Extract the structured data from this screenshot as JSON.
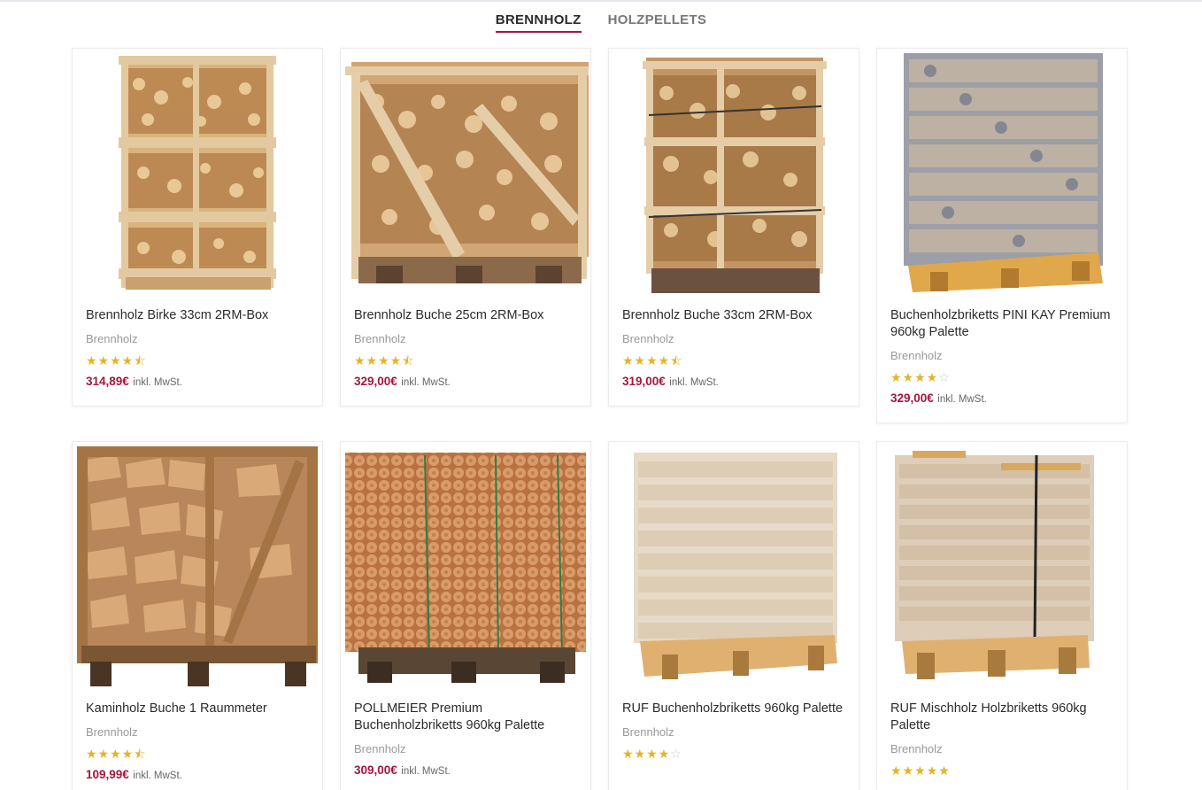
{
  "tabs": [
    {
      "label": "BRENNHOLZ",
      "active": true
    },
    {
      "label": "HOLZPELLETS",
      "active": false
    }
  ],
  "products": [
    {
      "title": "Brennholz Birke 33cm 2RM-Box",
      "category": "Brennholz",
      "rating": 4.5,
      "price": "314,89€",
      "tax_note": "inkl. MwSt.",
      "image": "stacked-birch-firewood-crates"
    },
    {
      "title": "Brennholz Buche 25cm 2RM-Box",
      "category": "Brennholz",
      "rating": 4.5,
      "price": "329,00€",
      "tax_note": "inkl. MwSt.",
      "image": "beech-firewood-crate-wrapped"
    },
    {
      "title": "Brennholz Buche 33cm 2RM-Box",
      "category": "Brennholz",
      "rating": 4.5,
      "price": "319,00€",
      "tax_note": "inkl. MwSt.",
      "image": "beech-firewood-crate-strapped"
    },
    {
      "title": "Buchenholzbriketts PINI KAY Premium 960kg Palette",
      "category": "Brennholz",
      "rating": 4,
      "price": "329,00€",
      "tax_note": "inkl. MwSt.",
      "image": "pini-kay-briquette-pallet"
    },
    {
      "title": "Kaminholz Buche 1 Raummeter",
      "category": "Brennholz",
      "rating": 4.5,
      "price": "109,99€",
      "tax_note": "inkl. MwSt.",
      "image": "fireplace-wood-crate"
    },
    {
      "title": "POLLMEIER Premium Buchenholzbriketts 960kg Palette",
      "category": "Brennholz",
      "rating": null,
      "price": "309,00€",
      "tax_note": "inkl. MwSt.",
      "image": "round-briquette-pallet"
    },
    {
      "title": "RUF Buchenholzbriketts 960kg Palette",
      "category": "Brennholz",
      "rating": 4,
      "price": null,
      "tax_note": null,
      "image": "ruf-beech-briquette-pallet"
    },
    {
      "title": "RUF Mischholz Holzbriketts 960kg Palette",
      "category": "Brennholz",
      "rating": 5,
      "price": null,
      "tax_note": null,
      "image": "ruf-mixed-briquette-pallet"
    }
  ],
  "colors": {
    "accent": "#a3173d",
    "star": "#e6b325",
    "wood_light": "#d9b27c",
    "wood_dark": "#a8763f"
  }
}
